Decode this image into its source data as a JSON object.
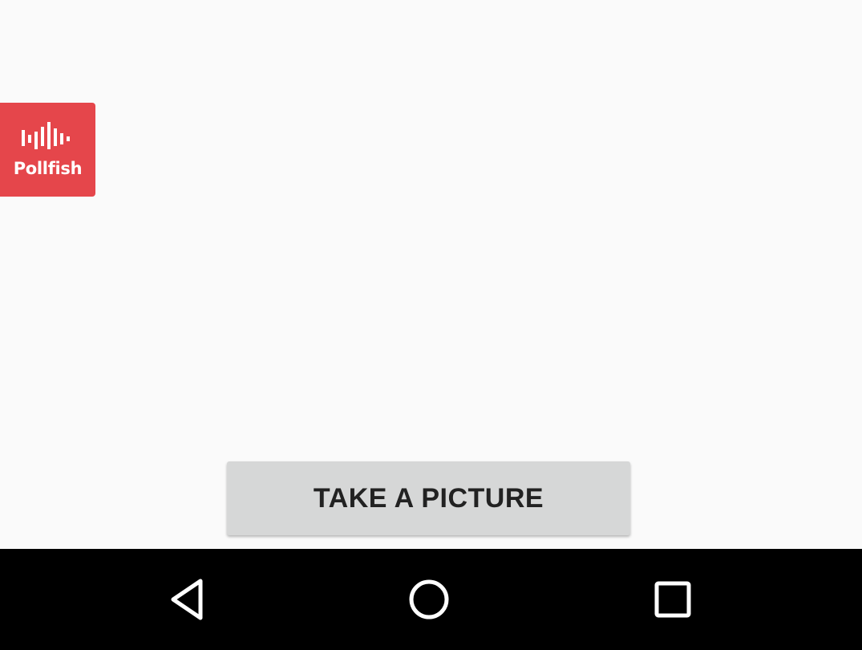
{
  "pollfish": {
    "label": "Pollfish",
    "icon": "pollfish-logo-icon",
    "color": "#e5464b"
  },
  "main": {
    "take_picture_label": "TAKE A PICTURE"
  },
  "navbar": {
    "back_icon": "back-triangle-icon",
    "home_icon": "home-circle-icon",
    "recents_icon": "recents-square-icon"
  },
  "colors": {
    "background": "#fafafa",
    "button_bg": "#d6d7d7",
    "navbar_bg": "#000000",
    "badge_bg": "#e5464b"
  }
}
